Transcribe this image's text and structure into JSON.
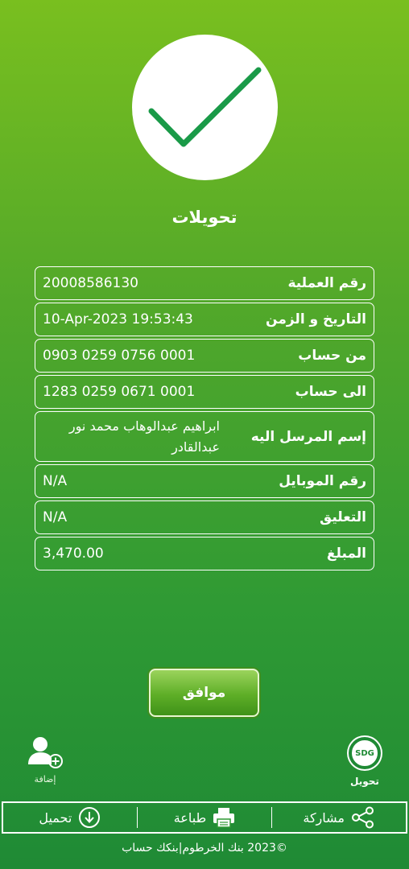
{
  "title": "تحويلات",
  "details": [
    {
      "label": "رقم العملية",
      "value": "20008586130"
    },
    {
      "label": "التاريخ و الزمن",
      "value": "10-Apr-2023 19:53:43"
    },
    {
      "label": "من حساب",
      "value": "0903 0259 0756 0001"
    },
    {
      "label": "الى حساب",
      "value": "1283 0259 0671 0001"
    },
    {
      "label": "إسم المرسل اليه",
      "value": "ابراهيم عبدالوهاب محمد نور عبدالقادر"
    },
    {
      "label": "رقم الموبايل",
      "value": "N/A"
    },
    {
      "label": "التعليق",
      "value": "N/A"
    },
    {
      "label": "المبلغ",
      "value": "3,470.00"
    }
  ],
  "ok_button": "موافق",
  "add_button": {
    "label": "إضافة",
    "icon": "add-user-icon"
  },
  "transfer_button": {
    "label": "تحويل",
    "badge": "SDG",
    "icon": "sdg-icon"
  },
  "toolbar": {
    "share": {
      "label": "مشاركة",
      "icon": "share-icon"
    },
    "print": {
      "label": "طباعة",
      "icon": "printer-icon"
    },
    "download": {
      "label": "تحميل",
      "icon": "download-icon"
    }
  },
  "footer": "©2023 بنك الخرطوم|بنكك حساب",
  "colors": {
    "check": "#1a9a48",
    "bg_top": "#79bf1f",
    "bg_bottom": "#1f8a35"
  }
}
